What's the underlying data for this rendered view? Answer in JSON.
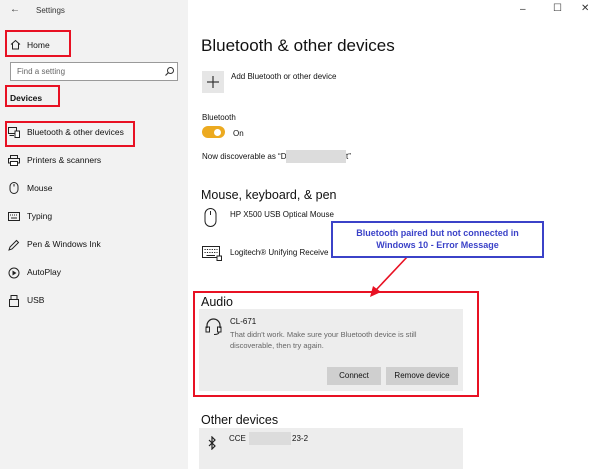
{
  "window": {
    "title": "Settings",
    "back_glyph": "←",
    "minimize_glyph": "–",
    "maximize_glyph": "☐",
    "close_glyph": "✕"
  },
  "sidebar": {
    "home_label": "Home",
    "search_placeholder": "Find a setting",
    "section_label": "Devices",
    "items": [
      {
        "label": "Bluetooth & other devices",
        "icon": "bluetooth-devices-icon"
      },
      {
        "label": "Printers & scanners",
        "icon": "printer-icon"
      },
      {
        "label": "Mouse",
        "icon": "mouse-icon"
      },
      {
        "label": "Typing",
        "icon": "keyboard-icon"
      },
      {
        "label": "Pen & Windows Ink",
        "icon": "pen-icon"
      },
      {
        "label": "AutoPlay",
        "icon": "autoplay-icon"
      },
      {
        "label": "USB",
        "icon": "usb-icon"
      }
    ]
  },
  "main": {
    "title": "Bluetooth & other devices",
    "add_device_label": "Add Bluetooth or other device",
    "bluetooth_label": "Bluetooth",
    "bluetooth_state": "On",
    "discoverable_prefix": "Now discoverable as “D",
    "discoverable_suffix": "t”",
    "mkp_heading": "Mouse, keyboard, & pen",
    "mkp_devices": [
      {
        "name": "HP X500 USB Optical Mouse",
        "icon": "mouse-icon"
      },
      {
        "name": "Logitech® Unifying Receive",
        "icon": "keyboard-icon"
      }
    ],
    "audio_heading": "Audio",
    "audio_device": {
      "name": "CL-671",
      "error_line1": "That didn't work. Make sure your Bluetooth device is still",
      "error_line2": "discoverable, then try again.",
      "connect_label": "Connect",
      "remove_label": "Remove device"
    },
    "other_heading": "Other devices",
    "other_device": {
      "name_prefix": "CCE",
      "name_suffix": "23-2"
    }
  },
  "annotation": {
    "line1": "Bluetooth paired but not connected in",
    "line2": "Windows 10 - Error Message"
  },
  "colors": {
    "accent_toggle": "#ecaa20",
    "highlight_red": "#e81123",
    "callout_blue": "#3b42c8"
  }
}
